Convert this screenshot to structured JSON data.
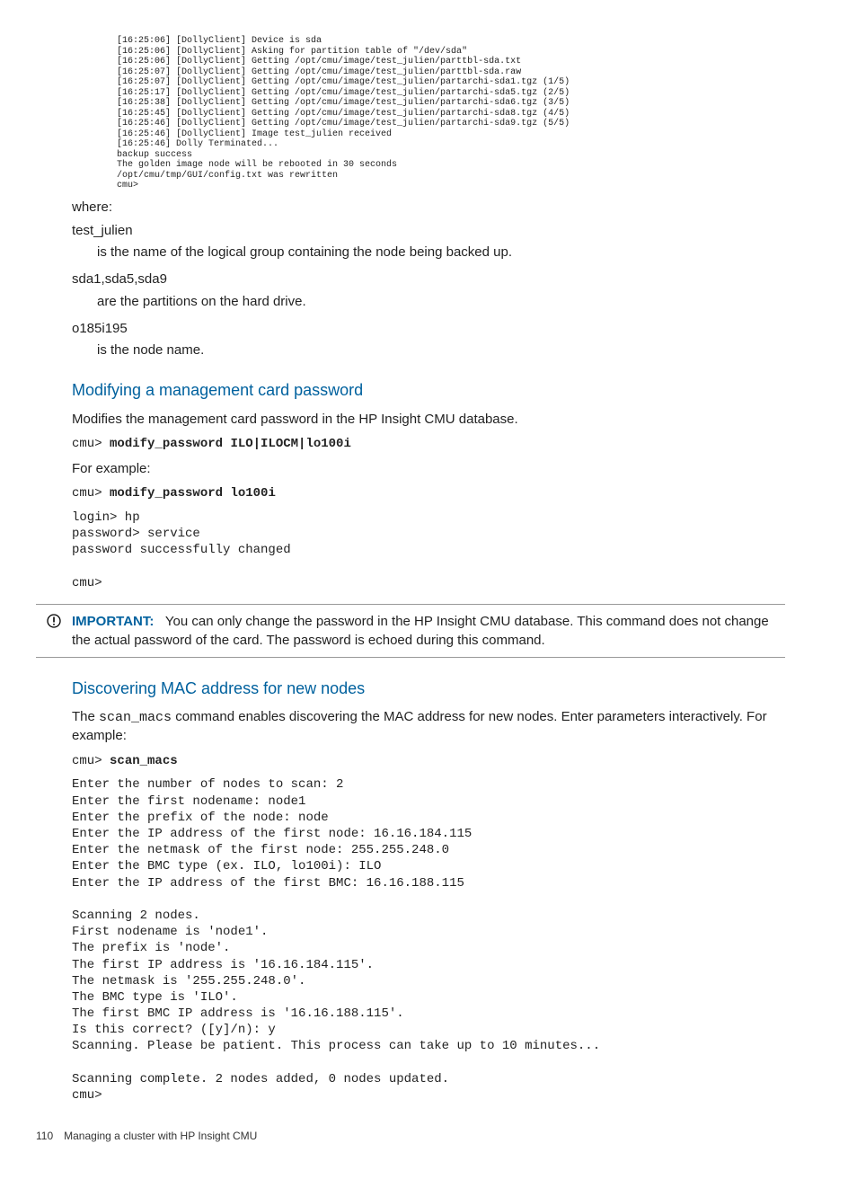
{
  "console_top": "[16:25:06] [DollyClient] Device is sda\n[16:25:06] [DollyClient] Asking for partition table of \"/dev/sda\"\n[16:25:06] [DollyClient] Getting /opt/cmu/image/test_julien/parttbl-sda.txt\n[16:25:07] [DollyClient] Getting /opt/cmu/image/test_julien/parttbl-sda.raw\n[16:25:07] [DollyClient] Getting /opt/cmu/image/test_julien/partarchi-sda1.tgz (1/5)\n[16:25:17] [DollyClient] Getting /opt/cmu/image/test_julien/partarchi-sda5.tgz (2/5)\n[16:25:38] [DollyClient] Getting /opt/cmu/image/test_julien/partarchi-sda6.tgz (3/5)\n[16:25:45] [DollyClient] Getting /opt/cmu/image/test_julien/partarchi-sda8.tgz (4/5)\n[16:25:46] [DollyClient] Getting /opt/cmu/image/test_julien/partarchi-sda9.tgz (5/5)\n[16:25:46] [DollyClient] Image test_julien received\n[16:25:46] Dolly Terminated...\nbackup success\nThe golden image node will be rebooted in 30 seconds\n/opt/cmu/tmp/GUI/config.txt was rewritten\ncmu>",
  "where_label": "where:",
  "term1": "test_julien",
  "def1": "is the name of the logical group containing the node being backed up.",
  "term2": "sda1,sda5,sda9",
  "def2": "are the partitions on the hard drive.",
  "term3": "o185i195",
  "def3": "is the node name.",
  "sec1_title": "Modifying a management card password",
  "sec1_body": "Modifies the management card password in the HP Insight CMU database.",
  "cmd1_prompt": "cmu> ",
  "cmd1_cmd": "modify_password ILO|ILOCM|lo100i",
  "for_example": "For example:",
  "cmd2_prompt": "cmu> ",
  "cmd2_cmd": "modify_password lo100i",
  "cmd2_output": "login> hp\npassword> service\npassword successfully changed\n\ncmu>",
  "important_label": "IMPORTANT:",
  "important_text": "You can only change the password in the HP Insight CMU database. This command does not change the actual password of the card. The password is echoed during this command.",
  "sec2_title": "Discovering MAC address for new nodes",
  "sec2_body_pre": "The ",
  "sec2_body_mono": "scan_macs",
  "sec2_body_post": " command enables discovering the MAC address for new nodes. Enter parameters interactively. For example:",
  "cmd3_prompt": "cmu> ",
  "cmd3_cmd": "scan_macs",
  "cmd3_output": "Enter the number of nodes to scan: 2\nEnter the first nodename: node1\nEnter the prefix of the node: node\nEnter the IP address of the first node: 16.16.184.115\nEnter the netmask of the first node: 255.255.248.0\nEnter the BMC type (ex. ILO, lo100i): ILO\nEnter the IP address of the first BMC: 16.16.188.115\n\nScanning 2 nodes.\nFirst nodename is 'node1'.\nThe prefix is 'node'.\nThe first IP address is '16.16.184.115'.\nThe netmask is '255.255.248.0'.\nThe BMC type is 'ILO'.\nThe first BMC IP address is '16.16.188.115'.\nIs this correct? ([y]/n): y\nScanning. Please be patient. This process can take up to 10 minutes...\n\nScanning complete. 2 nodes added, 0 nodes updated.\ncmu>",
  "footer_page": "110",
  "footer_text": "Managing a cluster with HP Insight CMU"
}
